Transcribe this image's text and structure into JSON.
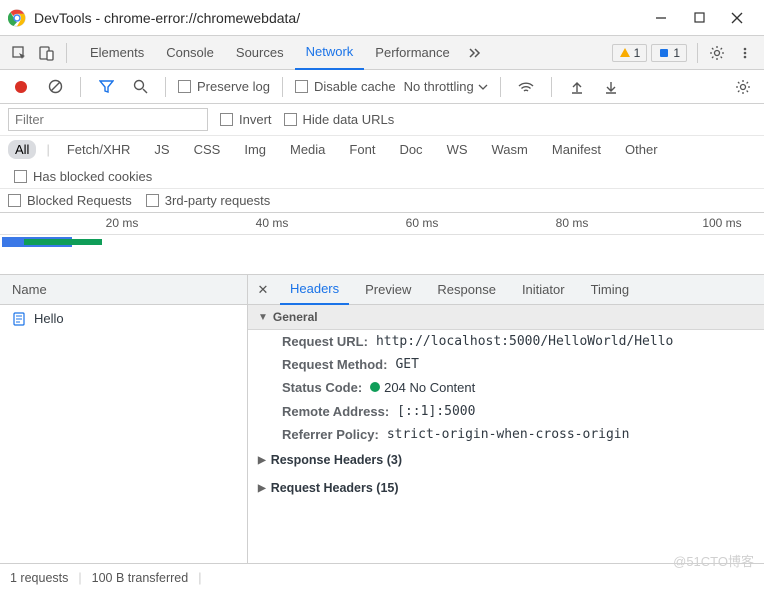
{
  "window": {
    "title": "DevTools - chrome-error://chromewebdata/"
  },
  "main_tabs": {
    "items": [
      "Elements",
      "Console",
      "Sources",
      "Network",
      "Performance"
    ],
    "active": "Network",
    "more_icon": "chevron-double-right"
  },
  "badges": {
    "warning_count": "1",
    "info_count": "1"
  },
  "net_toolbar": {
    "preserve_log": "Preserve log",
    "disable_cache": "Disable cache",
    "throttling": "No throttling"
  },
  "filter": {
    "placeholder": "Filter",
    "invert": "Invert",
    "hide_urls": "Hide data URLs"
  },
  "types": [
    "All",
    "Fetch/XHR",
    "JS",
    "CSS",
    "Img",
    "Media",
    "Font",
    "Doc",
    "WS",
    "Wasm",
    "Manifest",
    "Other"
  ],
  "types_active": "All",
  "has_blocked": "Has blocked cookies",
  "blocked_requests": "Blocked Requests",
  "third_party": "3rd-party requests",
  "timeline": {
    "ticks": [
      "20 ms",
      "40 ms",
      "60 ms",
      "80 ms",
      "100 ms"
    ]
  },
  "requests": {
    "column_name": "Name",
    "rows": [
      {
        "name": "Hello"
      }
    ]
  },
  "detail_tabs": {
    "items": [
      "Headers",
      "Preview",
      "Response",
      "Initiator",
      "Timing"
    ],
    "active": "Headers"
  },
  "general": {
    "title": "General",
    "request_url_k": "Request URL:",
    "request_url_v": "http://localhost:5000/HelloWorld/Hello",
    "request_method_k": "Request Method:",
    "request_method_v": "GET",
    "status_code_k": "Status Code:",
    "status_code_v": "204 No Content",
    "remote_address_k": "Remote Address:",
    "remote_address_v": "[::1]:5000",
    "referrer_policy_k": "Referrer Policy:",
    "referrer_policy_v": "strict-origin-when-cross-origin"
  },
  "response_headers": {
    "label": "Response Headers (3)"
  },
  "request_headers": {
    "label": "Request Headers (15)"
  },
  "status": {
    "requests": "1 requests",
    "transferred": "100 B transferred"
  },
  "watermark": "@51CTO博客"
}
